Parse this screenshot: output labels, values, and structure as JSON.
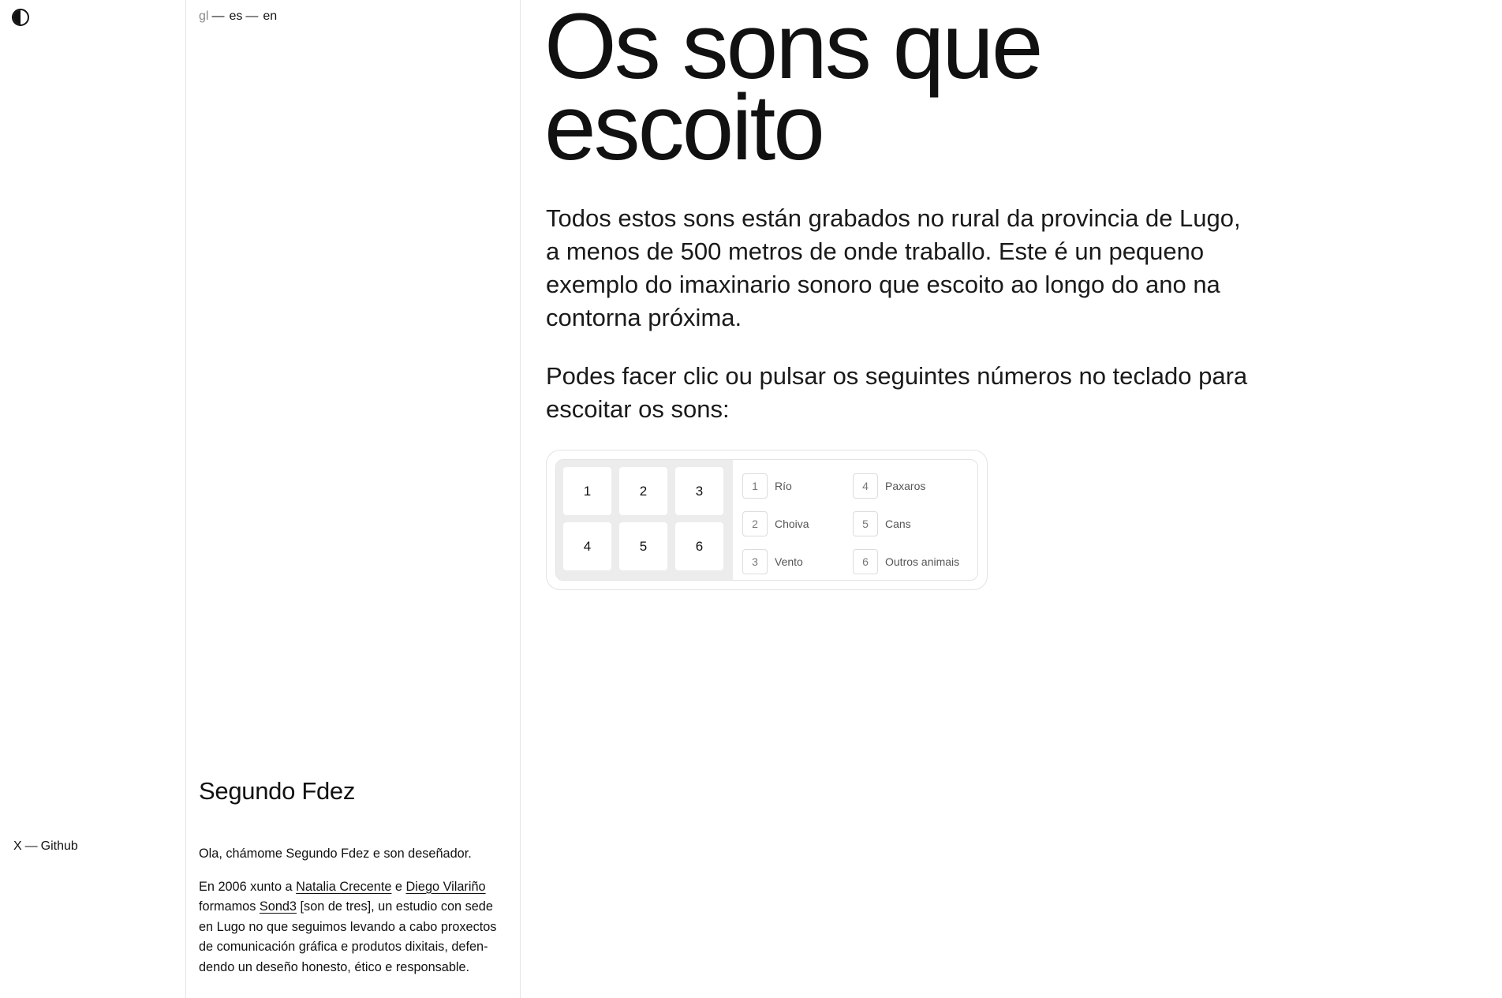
{
  "theme": {
    "icon": "half-circle-contrast-icon"
  },
  "languages": [
    {
      "code": "gl",
      "current": true
    },
    {
      "code": "es",
      "current": false
    },
    {
      "code": "en",
      "current": false
    }
  ],
  "language_separator": "—",
  "social": {
    "x": "X",
    "separator": "—",
    "github": "Github"
  },
  "author": {
    "name": "Segundo Fdez",
    "bio_line1": "Ola, chámome Segundo Fdez e son deseñador.",
    "bio2_text1": "En 2006 xunto a ",
    "bio2_link1": "Natalia Crecente",
    "bio2_text2": " e ",
    "bio2_link2": "Diego Vilariño",
    "bio2_text3": " formamos ",
    "bio2_link3": "Sond3",
    "bio2_text4": " [son de tres], un estudio con sede en Lugo no que seguimos levando a cabo proxectos de comunicación gráfica e produtos dixitais, defen­dendo un deseño honesto, ético e responsable."
  },
  "main": {
    "title": "Os sons que escoito",
    "intro": "Todos estos sons están grabados no rural da provincia de Lugo, a menos de 500 metros de onde traballo. Este é un pequeno exemplo do imaxinario sonoro que escoito ao longo do ano na contorna próxima.",
    "instruction": "Podes facer clic ou pulsar os seguintes números no teclado para escoitar os sons:"
  },
  "pad_keys": [
    "1",
    "2",
    "3",
    "4",
    "5",
    "6"
  ],
  "sounds": [
    {
      "key": "1",
      "label": "Río"
    },
    {
      "key": "2",
      "label": "Choiva"
    },
    {
      "key": "3",
      "label": "Vento"
    },
    {
      "key": "4",
      "label": "Paxaros"
    },
    {
      "key": "5",
      "label": "Cans"
    },
    {
      "key": "6",
      "label": "Outros animais"
    }
  ]
}
